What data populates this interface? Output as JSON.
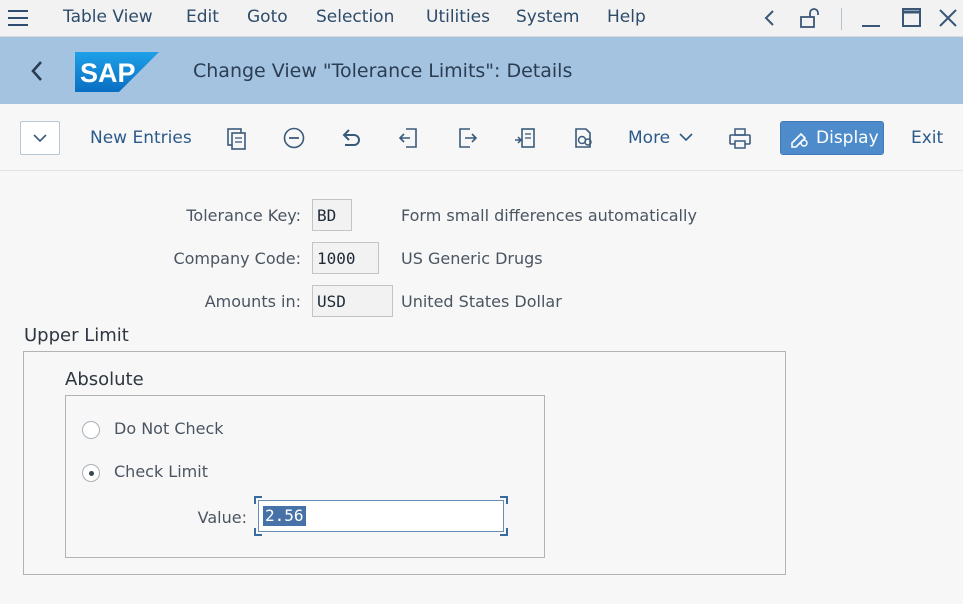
{
  "menu": {
    "items": [
      "Table View",
      "Edit",
      "Goto",
      "Selection",
      "Utilities",
      "System",
      "Help"
    ]
  },
  "window_controls": [
    "chevron-left-icon",
    "unlock-icon",
    "minimize-icon",
    "maximize-icon",
    "close-icon"
  ],
  "titlebar": {
    "logo_text": "SAP",
    "title": "Change View \"Tolerance Limits\": Details",
    "brand_color": "#1a8bd8"
  },
  "toolbar": {
    "new_entries": "New Entries",
    "more": "More",
    "display": "Display",
    "exit": "Exit",
    "icons": [
      "copy-icon",
      "delete-icon",
      "undo-icon",
      "previous-entry-icon",
      "next-entry-icon",
      "other-entry-icon",
      "find-icon",
      "print-icon"
    ]
  },
  "header_fields": {
    "tolerance_key": {
      "label": "Tolerance Key:",
      "value": "BD",
      "description": "Form small differences automatically"
    },
    "company_code": {
      "label": "Company Code:",
      "value": "1000",
      "description": "US Generic Drugs"
    },
    "amounts_in": {
      "label": "Amounts in:",
      "value": "USD",
      "description": "United States Dollar"
    }
  },
  "upper_limit": {
    "title": "Upper Limit",
    "absolute": {
      "title": "Absolute",
      "options": [
        {
          "label": "Do Not Check",
          "selected": false
        },
        {
          "label": "Check Limit",
          "selected": true
        }
      ],
      "value_label": "Value:",
      "value": "2.56"
    }
  },
  "colors": {
    "menubar_bg": "#f2f2f2",
    "titlebar_bg": "#a4c3e0",
    "display_button_bg": "#4d8bcb",
    "selection_bg": "#4672a8"
  }
}
